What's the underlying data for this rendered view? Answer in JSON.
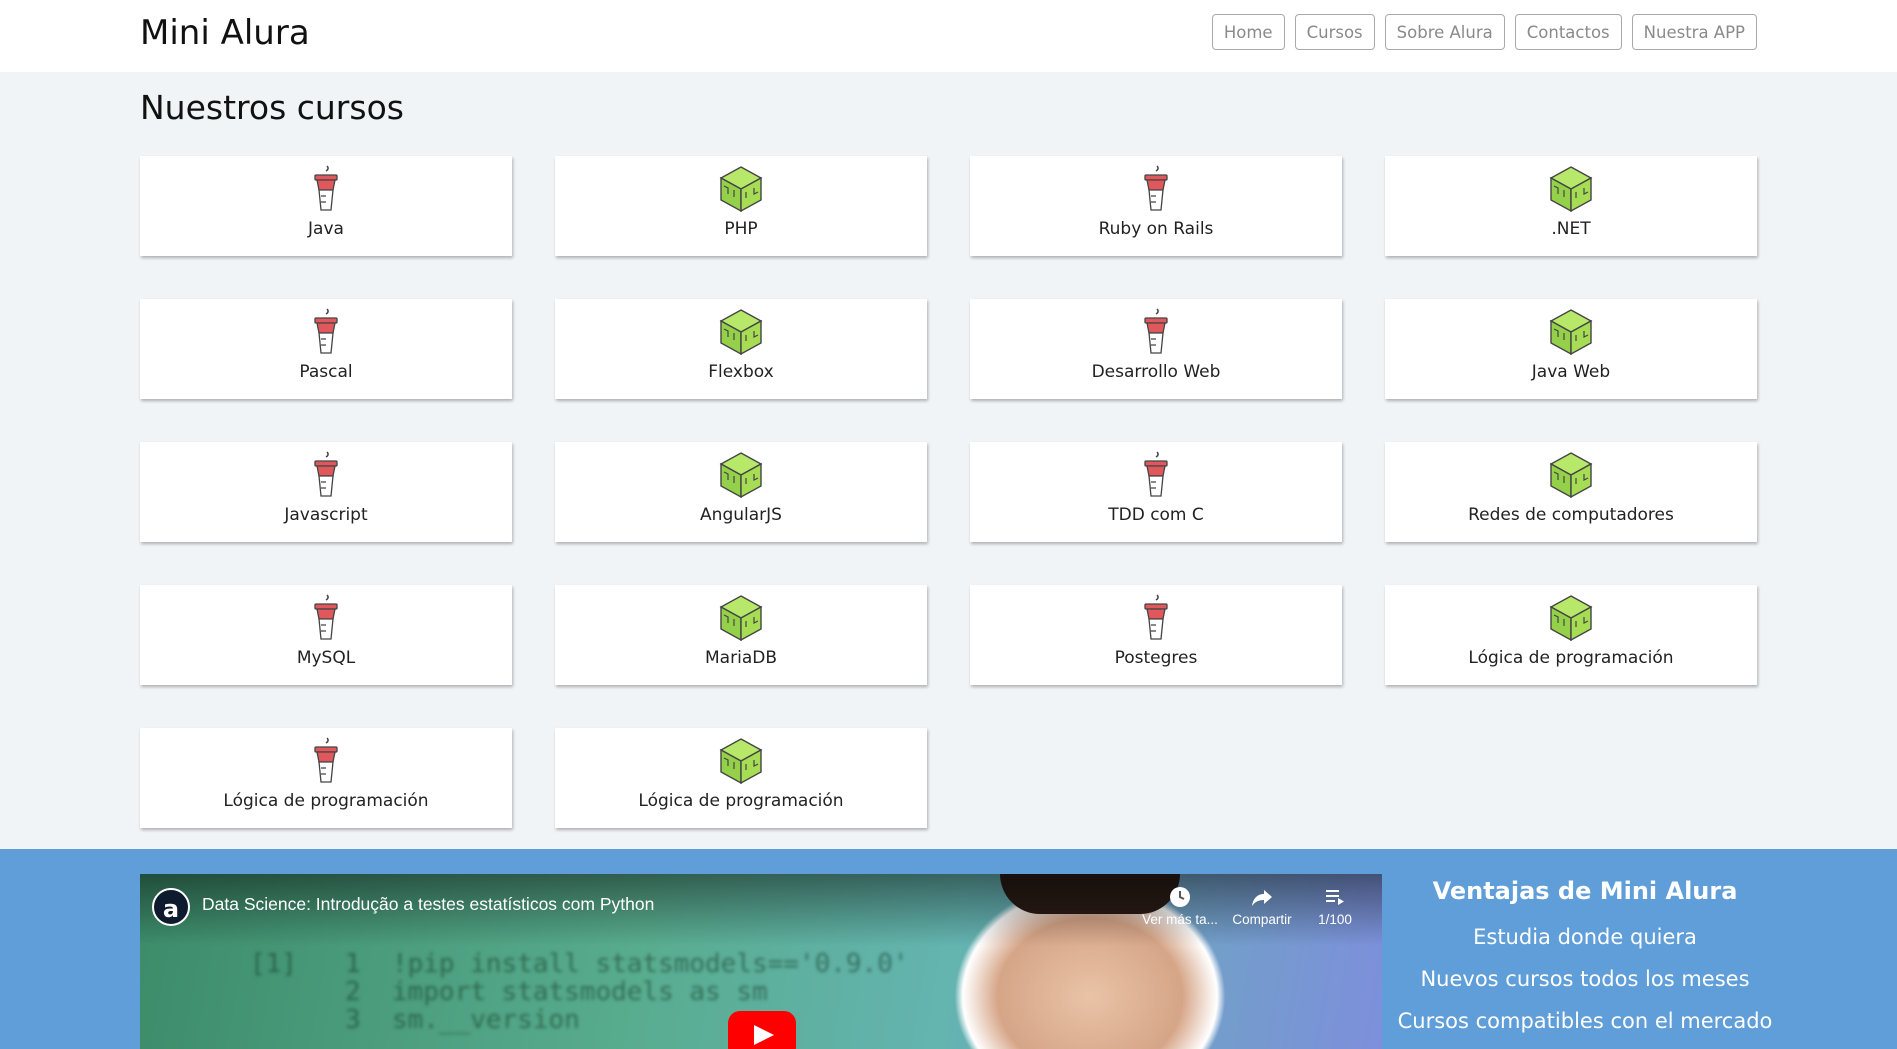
{
  "header": {
    "brand": "Mini Alura",
    "nav": [
      "Home",
      "Cursos",
      "Sobre Alura",
      "Contactos",
      "Nuestra APP"
    ]
  },
  "main": {
    "title": "Nuestros cursos",
    "courses": [
      {
        "label": "Java",
        "icon": "cup-icon"
      },
      {
        "label": "PHP",
        "icon": "cube-icon"
      },
      {
        "label": "Ruby on Rails",
        "icon": "cup-icon"
      },
      {
        "label": ".NET",
        "icon": "cube-icon"
      },
      {
        "label": "Pascal",
        "icon": "cup-icon"
      },
      {
        "label": "Flexbox",
        "icon": "cube-icon"
      },
      {
        "label": "Desarrollo Web",
        "icon": "cup-icon"
      },
      {
        "label": "Java Web",
        "icon": "cube-icon"
      },
      {
        "label": "Javascript",
        "icon": "cup-icon"
      },
      {
        "label": "AngularJS",
        "icon": "cube-icon"
      },
      {
        "label": "TDD com C",
        "icon": "cup-icon"
      },
      {
        "label": "Redes de computadores",
        "icon": "cube-icon"
      },
      {
        "label": "MySQL",
        "icon": "cup-icon"
      },
      {
        "label": "MariaDB",
        "icon": "cube-icon"
      },
      {
        "label": "Postegres",
        "icon": "cup-icon"
      },
      {
        "label": "Lógica de programación",
        "icon": "cube-icon"
      },
      {
        "label": "Lógica de programación",
        "icon": "cup-icon"
      },
      {
        "label": "Lógica de programación",
        "icon": "cube-icon"
      }
    ]
  },
  "video": {
    "channel_logo": "a",
    "title": "Data Science: Introdução a testes estatísticos com Python",
    "watch_later": "Ver más ta...",
    "share": "Compartir",
    "playlist": "1/100",
    "code": {
      "line1_num": "[1]",
      "line1": "1  !pip install statsmodels=='0.9.0'",
      "line2": "2  import statsmodels as sm",
      "line3": "3  sm.__version"
    }
  },
  "advantages": {
    "title": "Ventajas de Mini Alura",
    "items": [
      "Estudia donde quiera",
      "Nuevos cursos todos los meses",
      "Cursos compatibles con el mercado"
    ]
  },
  "colors": {
    "page_bg": "#f1f4f7",
    "footer_bg": "#5f9ed8",
    "cup_red": "#e0585b",
    "cube_green": "#a6dd54"
  }
}
